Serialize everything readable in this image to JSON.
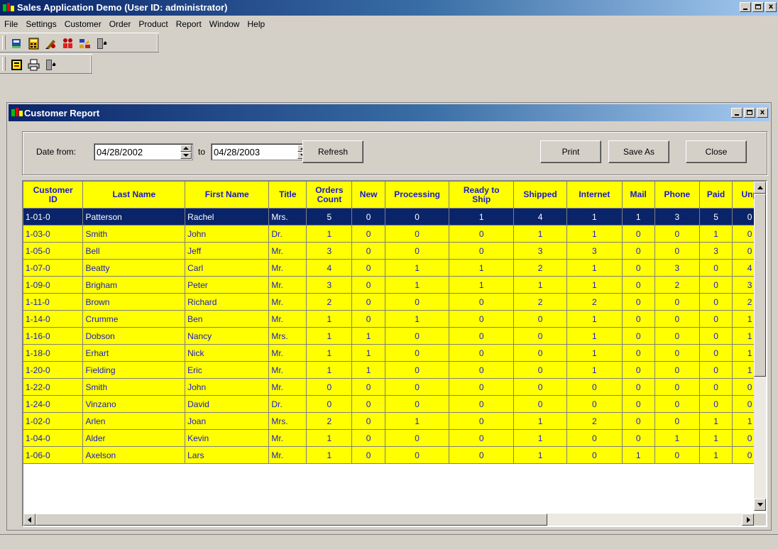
{
  "app": {
    "title": "Sales Application Demo (User ID: administrator)",
    "menu": [
      "File",
      "Settings",
      "Customer",
      "Order",
      "Product",
      "Report",
      "Window",
      "Help"
    ],
    "toolbar1_icons": [
      "book-icon",
      "calculator-icon",
      "pen-icon",
      "people-icon",
      "transfer-icon",
      "exit-door-icon"
    ],
    "toolbar2_icons": [
      "report-icon",
      "printer-icon",
      "exit-door-icon"
    ],
    "window_buttons": {
      "close": "x"
    }
  },
  "report": {
    "title": "Customer Report",
    "date_from_label": "Date from:",
    "date_from": "04/28/2002",
    "to_label": "to",
    "date_to": "04/28/2003",
    "refresh_label": "Refresh",
    "print_label": "Print",
    "save_as_label": "Save As",
    "close_label": "Close",
    "columns": [
      {
        "line1": "Customer",
        "line2": "ID"
      },
      {
        "line1": "Last Name",
        "line2": ""
      },
      {
        "line1": "First Name",
        "line2": ""
      },
      {
        "line1": "Title",
        "line2": ""
      },
      {
        "line1": "Orders",
        "line2": "Count"
      },
      {
        "line1": "New",
        "line2": ""
      },
      {
        "line1": "Processing",
        "line2": ""
      },
      {
        "line1": "Ready to",
        "line2": "Ship"
      },
      {
        "line1": "Shipped",
        "line2": ""
      },
      {
        "line1": "Internet",
        "line2": ""
      },
      {
        "line1": "Mail",
        "line2": ""
      },
      {
        "line1": "Phone",
        "line2": ""
      },
      {
        "line1": "Paid",
        "line2": ""
      },
      {
        "line1": "Unp",
        "line2": ""
      }
    ],
    "selected_row": 0,
    "rows": [
      [
        "1-01-0",
        "Patterson",
        "Rachel",
        "Mrs.",
        "5",
        "0",
        "0",
        "1",
        "4",
        "1",
        "1",
        "3",
        "5",
        "0"
      ],
      [
        "1-03-0",
        "Smith",
        "John",
        "Dr.",
        "1",
        "0",
        "0",
        "0",
        "1",
        "1",
        "0",
        "0",
        "1",
        "0"
      ],
      [
        "1-05-0",
        "Bell",
        "Jeff",
        "Mr.",
        "3",
        "0",
        "0",
        "0",
        "3",
        "3",
        "0",
        "0",
        "3",
        "0"
      ],
      [
        "1-07-0",
        "Beatty",
        "Carl",
        "Mr.",
        "4",
        "0",
        "1",
        "1",
        "2",
        "1",
        "0",
        "3",
        "0",
        "4"
      ],
      [
        "1-09-0",
        "Brigham",
        "Peter",
        "Mr.",
        "3",
        "0",
        "1",
        "1",
        "1",
        "1",
        "0",
        "2",
        "0",
        "3"
      ],
      [
        "1-11-0",
        "Brown",
        "Richard",
        "Mr.",
        "2",
        "0",
        "0",
        "0",
        "2",
        "2",
        "0",
        "0",
        "0",
        "2"
      ],
      [
        "1-14-0",
        "Crumme",
        "Ben",
        "Mr.",
        "1",
        "0",
        "1",
        "0",
        "0",
        "1",
        "0",
        "0",
        "0",
        "1"
      ],
      [
        "1-16-0",
        "Dobson",
        "Nancy",
        "Mrs.",
        "1",
        "1",
        "0",
        "0",
        "0",
        "1",
        "0",
        "0",
        "0",
        "1"
      ],
      [
        "1-18-0",
        "Erhart",
        "Nick",
        "Mr.",
        "1",
        "1",
        "0",
        "0",
        "0",
        "1",
        "0",
        "0",
        "0",
        "1"
      ],
      [
        "1-20-0",
        "Fielding",
        "Eric",
        "Mr.",
        "1",
        "1",
        "0",
        "0",
        "0",
        "1",
        "0",
        "0",
        "0",
        "1"
      ],
      [
        "1-22-0",
        "Smith",
        "John",
        "Mr.",
        "0",
        "0",
        "0",
        "0",
        "0",
        "0",
        "0",
        "0",
        "0",
        "0"
      ],
      [
        "1-24-0",
        "Vinzano",
        "David",
        "Dr.",
        "0",
        "0",
        "0",
        "0",
        "0",
        "0",
        "0",
        "0",
        "0",
        "0"
      ],
      [
        "1-02-0",
        "Arlen",
        "Joan",
        "Mrs.",
        "2",
        "0",
        "1",
        "0",
        "1",
        "2",
        "0",
        "0",
        "1",
        "1"
      ],
      [
        "1-04-0",
        "Alder",
        "Kevin",
        "Mr.",
        "1",
        "0",
        "0",
        "0",
        "1",
        "0",
        "0",
        "1",
        "1",
        "0"
      ],
      [
        "1-06-0",
        "Axelson",
        "Lars",
        "Mr.",
        "1",
        "0",
        "0",
        "0",
        "1",
        "0",
        "1",
        "0",
        "1",
        "0"
      ]
    ]
  },
  "colors": {
    "title_bar": "#0a246a",
    "grid_background": "#ffff00",
    "grid_text": "#1a1acc",
    "selected_row": "#0a246a"
  }
}
